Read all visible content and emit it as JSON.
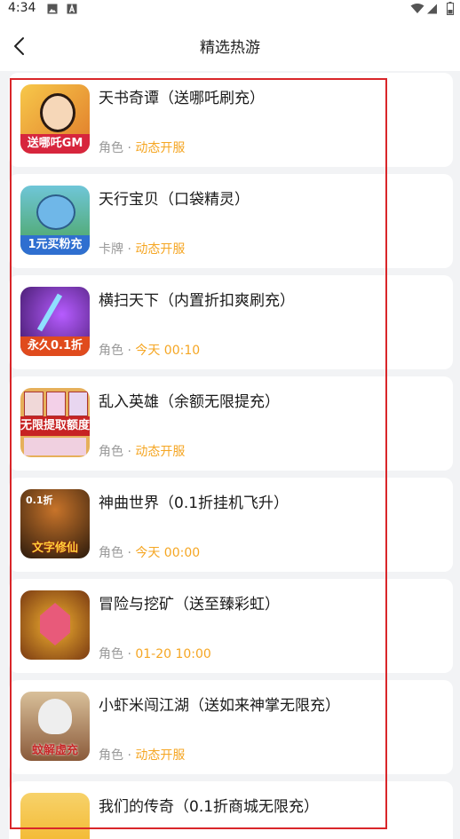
{
  "statusbar": {
    "time": "4:34"
  },
  "header": {
    "title": "精选热游"
  },
  "games": [
    {
      "name": "天书奇谭（送哪吒刷充）",
      "category": "角色",
      "separator": " · ",
      "open_time": "动态开服",
      "icon_text": "送哪吒GM",
      "icon_bg": "#e9a23b",
      "icon_fg": "#d7263d"
    },
    {
      "name": "天行宝贝（口袋精灵）",
      "category": "卡牌",
      "separator": " · ",
      "open_time": "动态开服",
      "icon_text": "1元买粉充",
      "icon_bg": "#5fb8c8",
      "icon_fg": "#3b7fd6"
    },
    {
      "name": "横扫天下（内置折扣爽刷充）",
      "category": "角色",
      "separator": " · ",
      "open_time": "今天 00:10",
      "icon_text": "永久0.1折",
      "icon_bg": "#5a2a8a",
      "icon_fg": "#e04b1d"
    },
    {
      "name": "乱入英雄（余额无限提充）",
      "category": "角色",
      "separator": " · ",
      "open_time": "动态开服",
      "icon_text": "无限提取额度",
      "icon_bg": "#d8a24a",
      "icon_fg": "#c72323"
    },
    {
      "name": "神曲世界（0.1折挂机飞升）",
      "category": "角色",
      "separator": " · ",
      "open_time": "今天 00:00",
      "icon_text": "文字修仙",
      "icon_bg": "#5b3a1e",
      "icon_fg": "#d23a1a"
    },
    {
      "name": "冒险与挖矿（送至臻彩虹）",
      "category": "角色",
      "separator": " · ",
      "open_time": "01-20 10:00",
      "icon_text": "",
      "icon_bg": "#6b3a18",
      "icon_fg": "#e24a6a"
    },
    {
      "name": "小虾米闯江湖（送如来神掌无限充）",
      "category": "角色",
      "separator": " · ",
      "open_time": "动态开服",
      "icon_text": "蚊解虚充",
      "icon_bg": "#8a6a4a",
      "icon_fg": "#c62828"
    },
    {
      "name": "我们的传奇（0.1折商城无限充）",
      "category": "",
      "separator": "",
      "open_time": "",
      "icon_text": "",
      "icon_bg": "#f2b01e",
      "icon_fg": "#f7d26a"
    }
  ],
  "colors": {
    "accent_time": "#f5a623",
    "highlight_box": "#d9262a"
  },
  "icons": {
    "back": "chevron-left-icon",
    "wifi": "wifi-icon",
    "signal": "signal-icon",
    "battery": "battery-icon"
  }
}
